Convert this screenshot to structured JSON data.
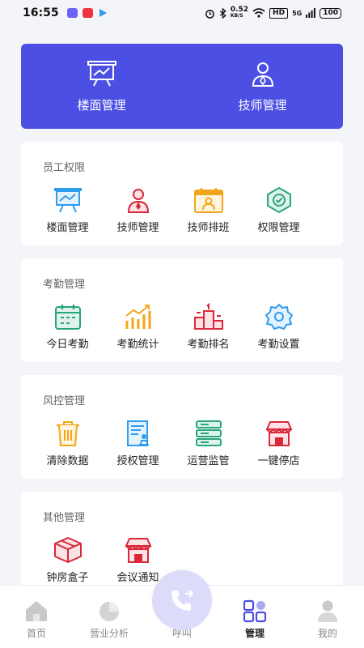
{
  "status_bar": {
    "time": "16:55",
    "speed": "0.52",
    "speed_unit": "KB/S",
    "hd": "HD",
    "signal": "5G",
    "battery": "100"
  },
  "banner": {
    "items": [
      {
        "label": "楼面管理",
        "icon": "presentation-board-icon"
      },
      {
        "label": "技师管理",
        "icon": "user-badge-icon"
      }
    ]
  },
  "sections": [
    {
      "title": "员工权限",
      "items": [
        {
          "label": "楼面管理",
          "icon": "presentation-board-icon"
        },
        {
          "label": "技师管理",
          "icon": "technician-icon"
        },
        {
          "label": "技师排班",
          "icon": "schedule-calendar-icon"
        },
        {
          "label": "权限管理",
          "icon": "shield-check-icon"
        }
      ]
    },
    {
      "title": "考勤管理",
      "items": [
        {
          "label": "今日考勤",
          "icon": "calendar-check-icon"
        },
        {
          "label": "考勤统计",
          "icon": "bar-trend-icon"
        },
        {
          "label": "考勤排名",
          "icon": "podium-icon"
        },
        {
          "label": "考勤设置",
          "icon": "gear-icon"
        }
      ]
    },
    {
      "title": "风控管理",
      "items": [
        {
          "label": "清除数据",
          "icon": "trash-icon"
        },
        {
          "label": "授权管理",
          "icon": "authorize-document-icon"
        },
        {
          "label": "运营监管",
          "icon": "server-icon"
        },
        {
          "label": "一键停店",
          "icon": "store-icon"
        }
      ]
    },
    {
      "title": "其他管理",
      "items": [
        {
          "label": "钟房盒子",
          "icon": "box-icon"
        },
        {
          "label": "会议通知",
          "icon": "store-notice-icon"
        }
      ]
    }
  ],
  "bottom_nav": [
    {
      "label": "首页",
      "icon": "home-icon",
      "active": false
    },
    {
      "label": "营业分析",
      "icon": "pie-chart-icon",
      "active": false
    },
    {
      "label": "呼叫",
      "icon": "phone-call-icon",
      "active": false
    },
    {
      "label": "管理",
      "icon": "grid-manage-icon",
      "active": true
    },
    {
      "label": "我的",
      "icon": "person-icon",
      "active": false
    }
  ],
  "colors": {
    "accent": "#4b4fe3",
    "blue": "#2f9cf0",
    "red": "#d8283a",
    "orange": "#f2a51a",
    "teal": "#2aa37f",
    "nav_inactive": "#bcbcbc",
    "nav_active": "#4b4fe3"
  }
}
